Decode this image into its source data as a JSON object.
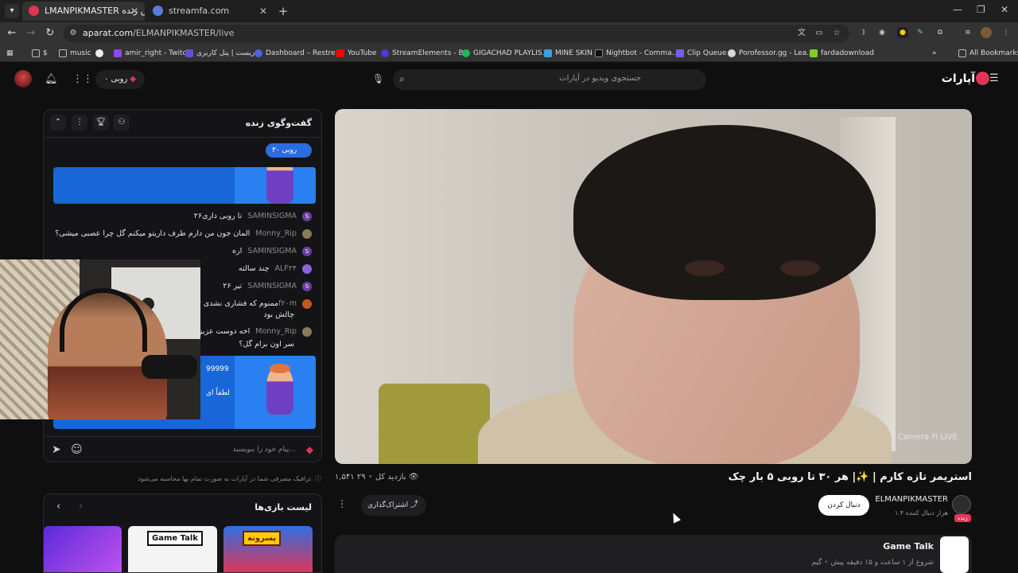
{
  "browser": {
    "tabs": [
      {
        "label": "LMANPIKMASTER پخش زنده 🔊",
        "active": true
      },
      {
        "label": "streamfa.com",
        "active": false
      }
    ],
    "url_host": "aparat.com",
    "url_path": "/ELMANPIKMASTER/live",
    "bookmarks": [
      {
        "label": "$"
      },
      {
        "label": "music"
      },
      {
        "label": ""
      },
      {
        "label": "amir_right - Twitch"
      },
      {
        "label": "ریست | پنل کاربری"
      },
      {
        "label": "Dashboard – Restre..."
      },
      {
        "label": "YouTube"
      },
      {
        "label": "StreamElements - B..."
      },
      {
        "label": "GIGACHAD PLAYLIS..."
      },
      {
        "label": "MINE SKIN"
      },
      {
        "label": "Nightbot - Comma..."
      },
      {
        "label": "Clip Queue"
      },
      {
        "label": "Porofessor.gg - Lea..."
      },
      {
        "label": "fardadownload"
      },
      {
        "label": "All Bookmarks"
      }
    ]
  },
  "header": {
    "logo": "آپارات",
    "search_placeholder": "جستجوی ویدیو در آپارات",
    "rubi_balance": "۰ روبی"
  },
  "video": {
    "watermark": "Camera Fi LIVE",
    "title": "استریمر تازه کارم | ✨| هر ۳۰ تا روبی ۵ بار چک",
    "views": "۱,۵۴۱ بازدید کل",
    "live_viewers": "۲۹",
    "channel_name": "ELMANPIKMASTER",
    "followers": "۱.۴ هزار دنبال کننده",
    "live_label": "زنده",
    "follow_label": "دنبال کردن",
    "share_label": "اشتراک‌گذاری"
  },
  "game": {
    "name": "Game Talk",
    "category": "گیم",
    "started": "شروع از ۱ ساعت و ۱۵ دقیقه پیش"
  },
  "chat": {
    "title": "گفت‌وگوی زنده",
    "rubi_pill": "۳۰ روبی",
    "messages": [
      {
        "user": "SAMINSIGMA",
        "text": "۲۶تا روبی داری"
      },
      {
        "user": "Monny_Rip",
        "text": "المان جون من دارم طرف داریتو میکنم گل چرا عصبی میشی؟"
      },
      {
        "user": "SAMINSIGMA",
        "text": "اره"
      },
      {
        "user": "ALF۲۴",
        "text": "چند سالته"
      },
      {
        "user": "SAMINSIGMA",
        "text": "۲۶ تیر"
      },
      {
        "user": "۲f۲۰m",
        "text": "ممنوم که فشاری نشدی تبریک"
      },
      {
        "user": "",
        "text": "چالش بود"
      },
      {
        "user": "Monny_Rip",
        "text": "اخه دوست عزیز اون ط"
      },
      {
        "user": "",
        "text": "سر اون بزام گل؟"
      }
    ],
    "donation_amount": "99999",
    "donation_text": "لطفاً ای",
    "input_placeholder": "پیام خود را بنویسید...",
    "traffic_note": "ترافیک مصرفی شما در آپارات به صورت تمام بها محاسبه می‌شود."
  },
  "games": {
    "title": "لیست بازی‌ها",
    "items": [
      {
        "label": "Game Talk"
      },
      {
        "label": "پسرونه"
      }
    ]
  },
  "colors": {
    "brand": "#e03556",
    "chat_blue": "#1966d8",
    "page_bg": "#0f0f10"
  }
}
